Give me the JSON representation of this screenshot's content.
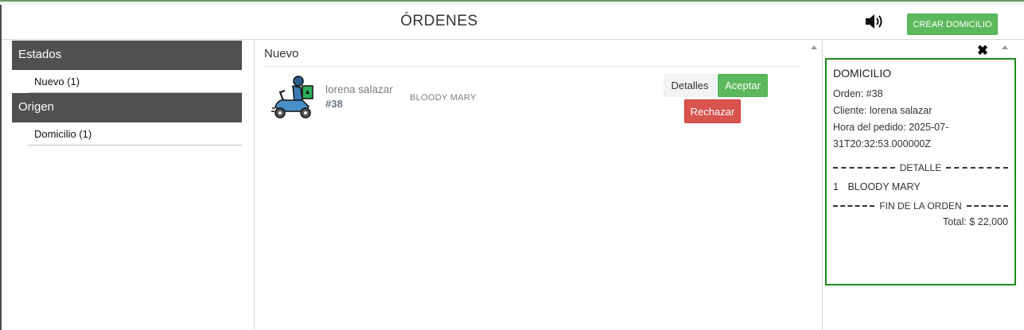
{
  "header": {
    "title": "ÓRDENES",
    "create_button": "CREAR DOMICILIO"
  },
  "sidebar": {
    "states_heading": "Estados",
    "states_items": [
      {
        "label": "Nuevo (1)"
      }
    ],
    "origin_heading": "Origen",
    "origin_items": [
      {
        "label": "Domicilio (1)"
      }
    ]
  },
  "main": {
    "section_title": "Nuevo",
    "orders": [
      {
        "customer": "lorena salazar",
        "number": "#38",
        "product": "BLOODY MARY",
        "details_label": "Detalles",
        "accept_label": "Aceptar",
        "reject_label": "Rechazar"
      }
    ]
  },
  "receipt": {
    "title": "DOMICILIO",
    "order_line": "Orden: #38",
    "client_line": "Cliente: lorena salazar",
    "time_line": "Hora del pedido: 2025-07-31T20:32:53.000000Z",
    "detail_sep": "DETALLE",
    "item_qty": "1",
    "item_name": "BLOODY MARY",
    "end_sep": "FIN DE LA ORDEN",
    "total": "Total: $ 22,000"
  },
  "colors": {
    "accent_green": "#5cb85c",
    "danger_red": "#d9534f",
    "receipt_border": "#1e8a1e",
    "sidebar_heading": "#505050"
  },
  "icons": [
    "volume-icon",
    "delivery-scooter-icon",
    "close-icon"
  ]
}
